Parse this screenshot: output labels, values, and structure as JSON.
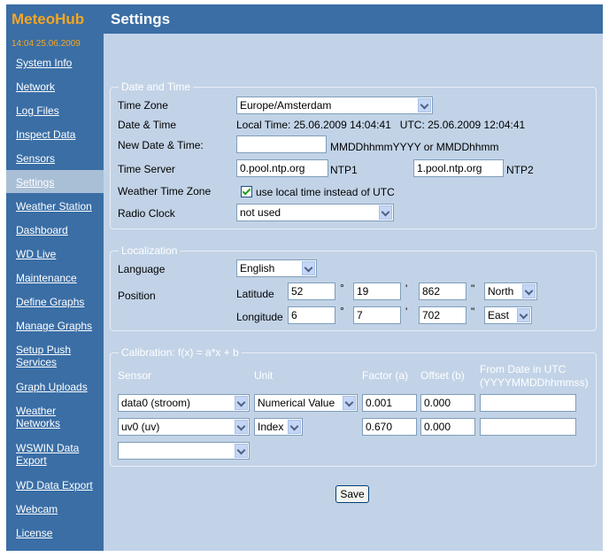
{
  "sidebar": {
    "brand": "MeteoHub",
    "datetime": "14:04   25.06.2009",
    "items": [
      {
        "label": "System Info"
      },
      {
        "label": "Network"
      },
      {
        "label": "Log Files"
      },
      {
        "label": "Inspect Data"
      },
      {
        "label": "Sensors"
      },
      {
        "label": "Settings"
      },
      {
        "label": "Weather Station"
      },
      {
        "label": "Dashboard"
      },
      {
        "label": "WD Live"
      },
      {
        "label": "Maintenance"
      },
      {
        "label": "Define Graphs"
      },
      {
        "label": "Manage Graphs"
      },
      {
        "label": "Setup Push",
        "label2": "Services"
      },
      {
        "label": "Graph Uploads"
      },
      {
        "label": "Weather",
        "label2": "Networks"
      },
      {
        "label": "WSWIN Data",
        "label2": "Export"
      },
      {
        "label": "WD Data Export"
      },
      {
        "label": "Webcam"
      },
      {
        "label": "License"
      }
    ]
  },
  "header": {
    "title": "Settings"
  },
  "datetime_section": {
    "legend": "Date and Time",
    "timezone_label": "Time Zone",
    "timezone_value": "Europe/Amsterdam",
    "datetime_label": "Date & Time",
    "datetime_value": "Local Time: 25.06.2009 14:04:41   UTC: 25.06.2009 12:04:41",
    "newdate_label": "New Date & Time:",
    "newdate_value": "",
    "newdate_hint": "MMDDhhmmYYYY or MMDDhhmm",
    "timeserver_label": "Time Server",
    "ntp1_value": "0.pool.ntp.org",
    "ntp1_label": "NTP1",
    "ntp2_value": "1.pool.ntp.org",
    "ntp2_label": "NTP2",
    "weather_tz_label": "Weather Time Zone",
    "weather_tz_checked": true,
    "weather_tz_text": "use local time instead of UTC",
    "radio_label": "Radio Clock",
    "radio_value": "not used"
  },
  "localization": {
    "legend": "Localization",
    "language_label": "Language",
    "language_value": "English",
    "position_label": "Position",
    "latitude_label": "Latitude",
    "lat_deg": "52",
    "lat_min": "19",
    "lat_sec": "862",
    "lat_dir": "North",
    "longitude_label": "Longitude",
    "lon_deg": "6",
    "lon_min": "7",
    "lon_sec": "702",
    "lon_dir": "East",
    "deg_symbol": "°",
    "min_symbol": "'",
    "sec_symbol": "\""
  },
  "calibration": {
    "legend": "Calibration: f(x) = a*x + b",
    "col_sensor": "Sensor",
    "col_unit": "Unit",
    "col_factor": "Factor (a)",
    "col_offset": "Offset (b)",
    "col_from_1": "From Date in UTC",
    "col_from_2": "(YYYYMMDDhhmmss)",
    "rows": [
      {
        "sensor": "data0 (stroom)",
        "unit": "Numerical Value",
        "factor": "0.001",
        "offset": "0.000",
        "from": ""
      },
      {
        "sensor": "uv0 (uv)",
        "unit": "Index",
        "factor": "0.670",
        "offset": "0.000",
        "from": ""
      },
      {
        "sensor": ""
      }
    ]
  },
  "save_label": "Save"
}
